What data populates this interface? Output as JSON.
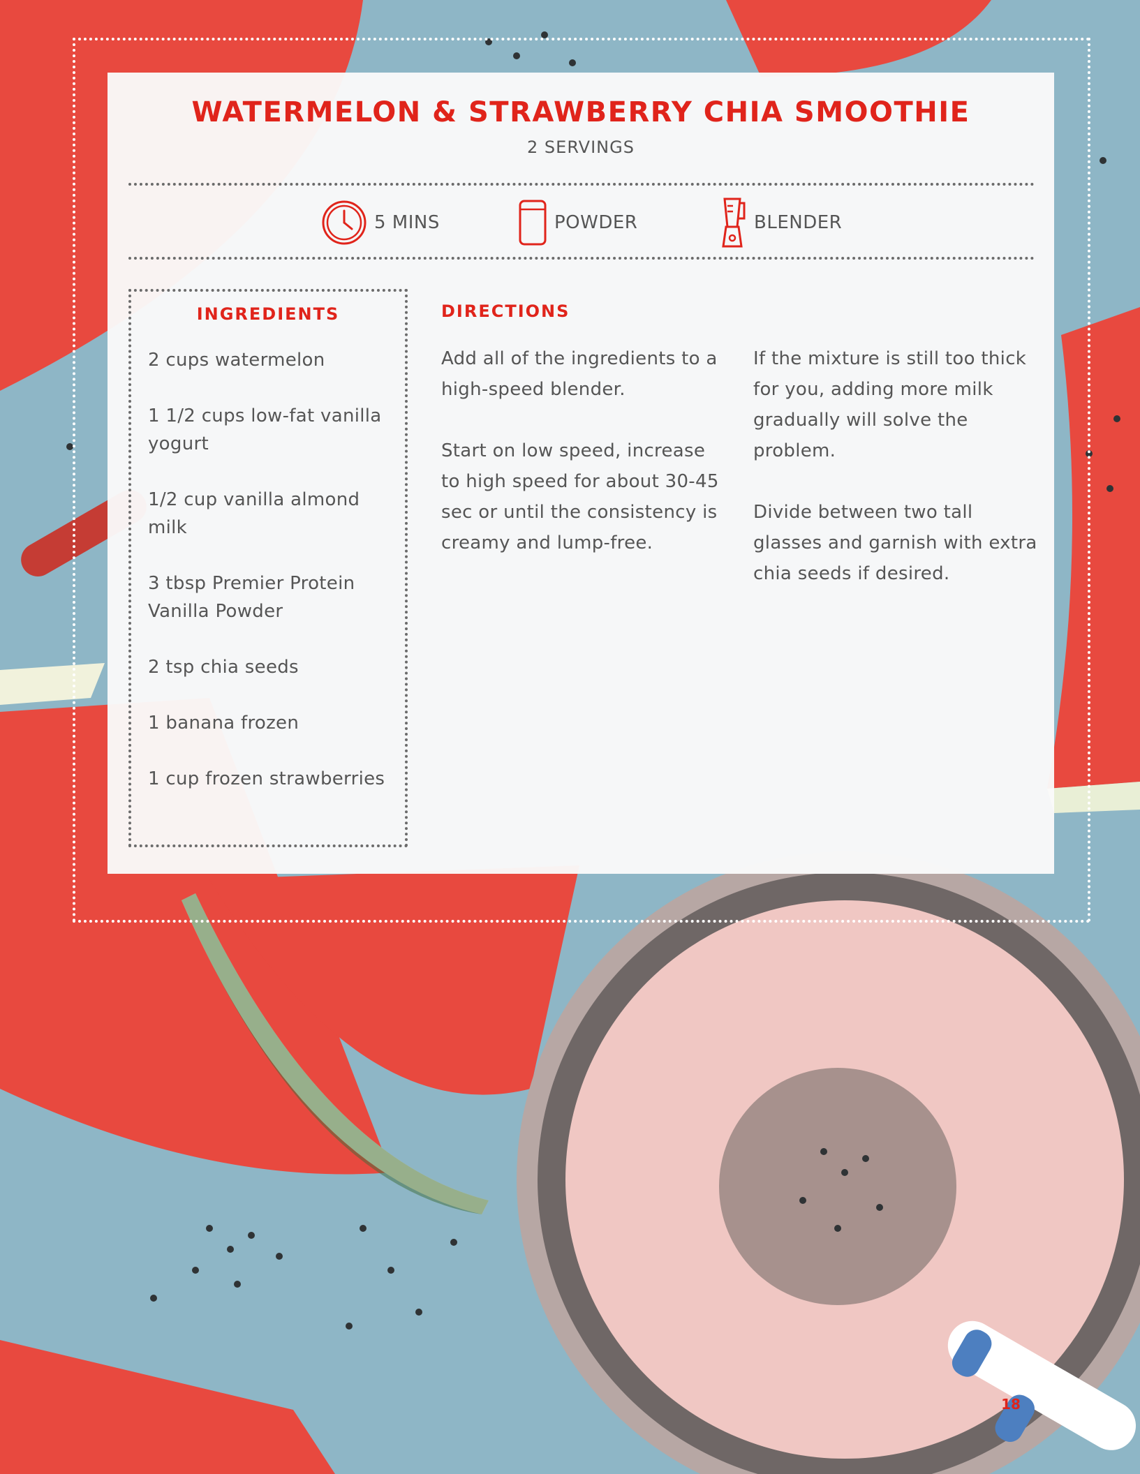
{
  "recipe": {
    "title": "WATERMELON & STRAWBERRY CHIA SMOOTHIE",
    "servings": "2  SERVINGS"
  },
  "meta": {
    "time_label": "5 MINS",
    "powder_label": "POWDER",
    "blender_label": "BLENDER"
  },
  "ingredients": {
    "heading": "INGREDIENTS",
    "items": [
      "2 cups watermelon",
      "1 1/2 cups low-fat vanilla yogurt",
      "1/2 cup vanilla almond milk",
      "3 tbsp Premier Protein Vanilla Powder",
      "2 tsp chia seeds",
      "1 banana frozen",
      "1 cup frozen strawberries"
    ]
  },
  "directions": {
    "heading": "DIRECTIONS",
    "column1": [
      "Add all of the ingredients to a high-speed blender.",
      "Start on low speed, increase to high speed for about 30-45 sec or until the consistency is creamy and lump-free."
    ],
    "column2": [
      "If the mixture is still too thick for you, adding more milk gradually will solve the problem.",
      "Divide between two tall glasses and garnish with extra chia seeds if desired."
    ]
  },
  "page_number": "18",
  "colors": {
    "accent": "#e0241b",
    "text": "#555555",
    "background": "#8eb6c6",
    "card": "#fafafa"
  }
}
